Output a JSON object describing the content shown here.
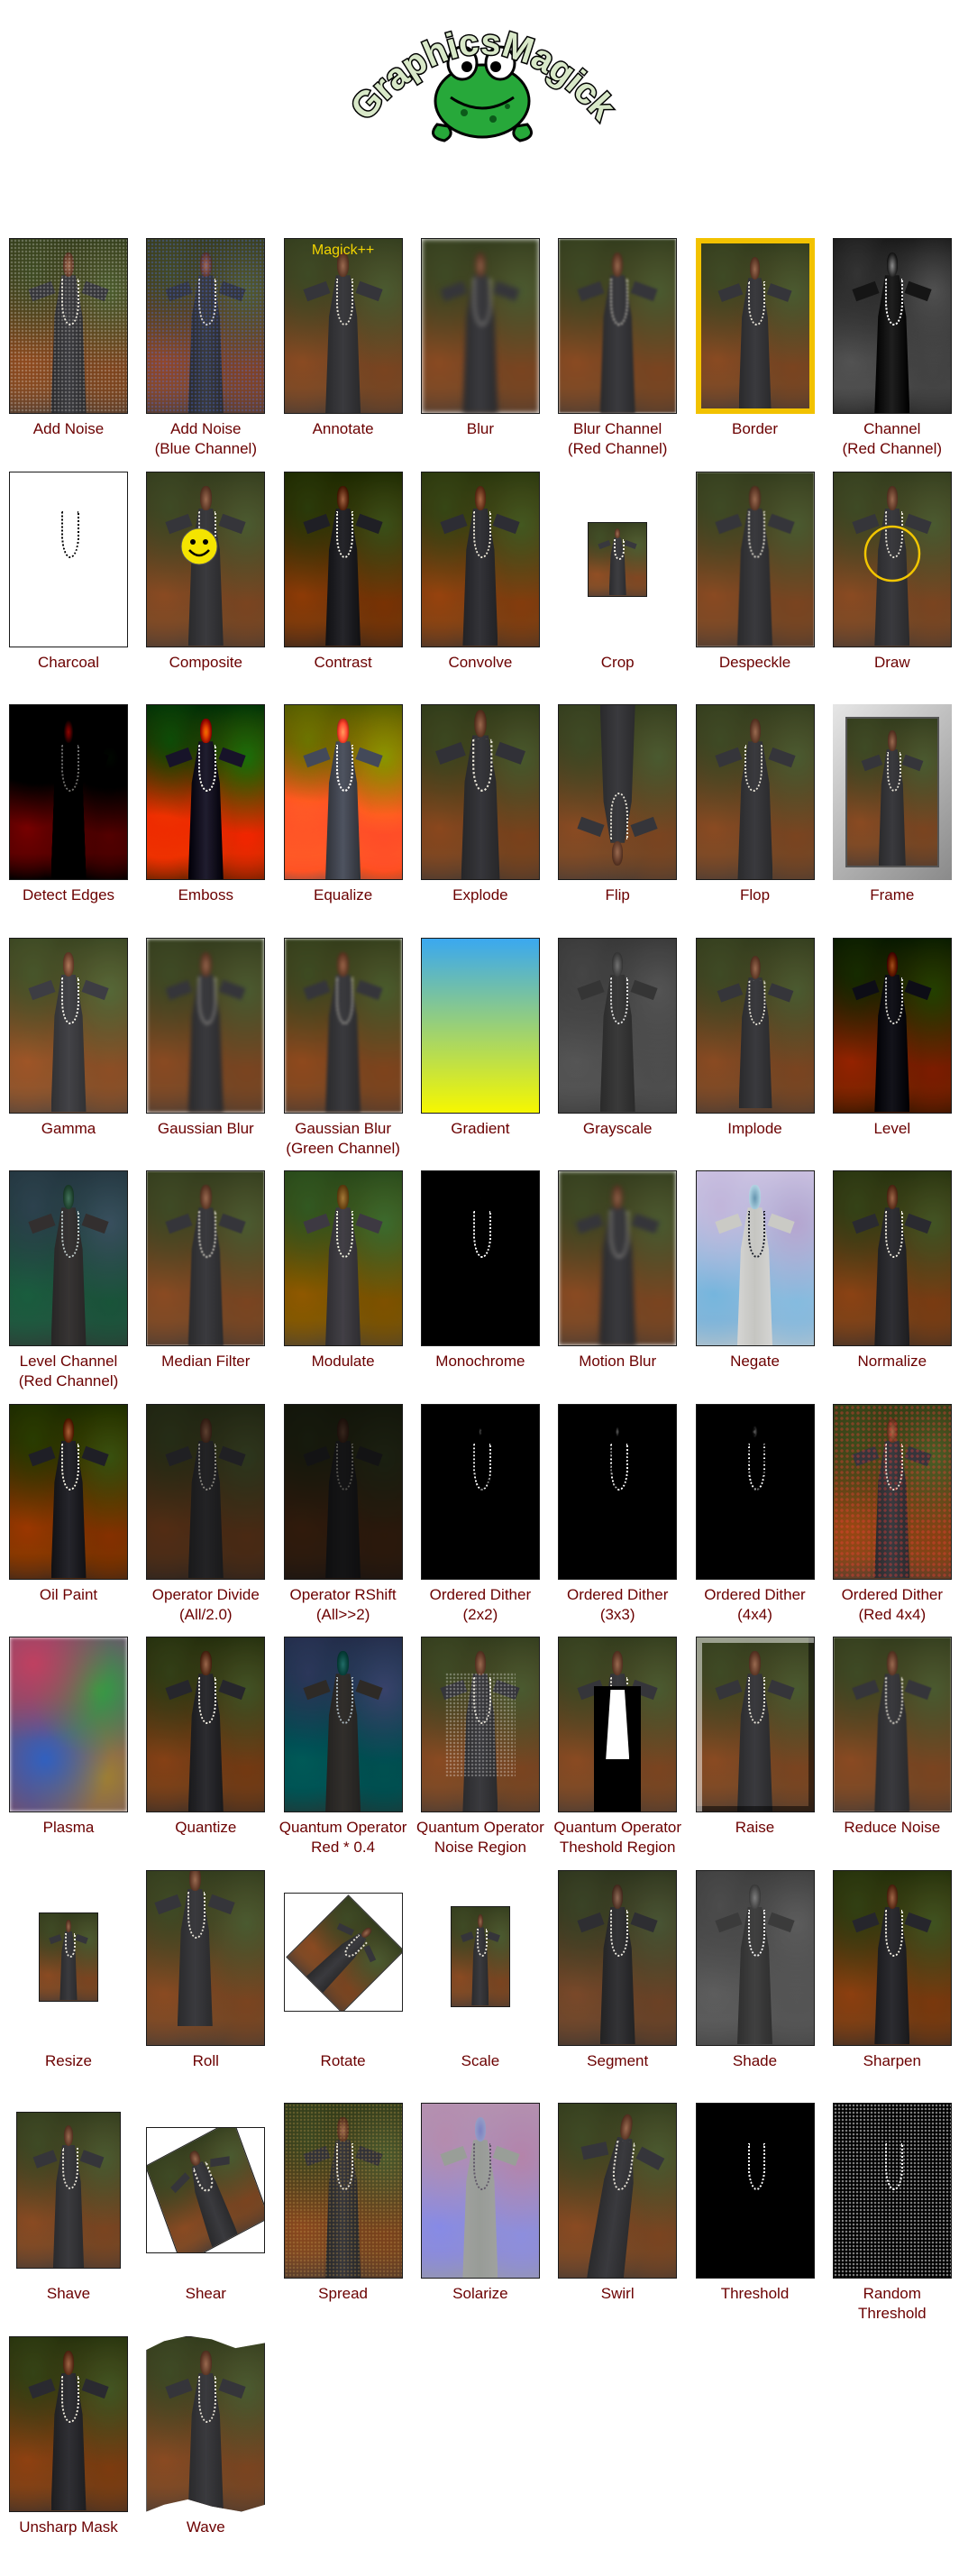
{
  "logo": {
    "text": "GraphicsMagick"
  },
  "colors": {
    "label": "#6b0000",
    "border": "#1a1a1a",
    "border_frame": "#f2c200",
    "annotate": "#f2d400"
  },
  "annotate_text": "Magick++",
  "items": [
    {
      "label": "Add Noise",
      "effect": "noise"
    },
    {
      "label": "Add Noise\n(Blue Channel)",
      "effect": "noise-blue"
    },
    {
      "label": "Annotate",
      "effect": "annotate"
    },
    {
      "label": "Blur",
      "effect": "blur"
    },
    {
      "label": "Blur Channel\n(Red Channel)",
      "effect": "blur-red"
    },
    {
      "label": "Border",
      "effect": "border"
    },
    {
      "label": "Channel\n(Red Channel)",
      "effect": "channel-red"
    },
    {
      "label": "Charcoal",
      "effect": "charcoal"
    },
    {
      "label": "Composite",
      "effect": "composite"
    },
    {
      "label": "Contrast",
      "effect": "contrast"
    },
    {
      "label": "Convolve",
      "effect": "convolve"
    },
    {
      "label": "Crop",
      "effect": "crop"
    },
    {
      "label": "Despeckle",
      "effect": "despeckle"
    },
    {
      "label": "Draw",
      "effect": "draw"
    },
    {
      "label": "Detect Edges",
      "effect": "edges"
    },
    {
      "label": "Emboss",
      "effect": "emboss"
    },
    {
      "label": "Equalize",
      "effect": "equalize"
    },
    {
      "label": "Explode",
      "effect": "explode"
    },
    {
      "label": "Flip",
      "effect": "flip"
    },
    {
      "label": "Flop",
      "effect": "flop"
    },
    {
      "label": "Frame",
      "effect": "frame"
    },
    {
      "label": "Gamma",
      "effect": "gamma"
    },
    {
      "label": "Gaussian Blur",
      "effect": "gblur"
    },
    {
      "label": "Gaussian Blur\n(Green Channel)",
      "effect": "gblur-green"
    },
    {
      "label": "Gradient",
      "effect": "gradient"
    },
    {
      "label": "Grayscale",
      "effect": "grayscale"
    },
    {
      "label": "Implode",
      "effect": "implode"
    },
    {
      "label": "Level",
      "effect": "level"
    },
    {
      "label": "Level Channel\n(Red Channel)",
      "effect": "level-red"
    },
    {
      "label": "Median Filter",
      "effect": "median"
    },
    {
      "label": "Modulate",
      "effect": "modulate"
    },
    {
      "label": "Monochrome",
      "effect": "mono"
    },
    {
      "label": "Motion Blur",
      "effect": "motion"
    },
    {
      "label": "Negate",
      "effect": "negate"
    },
    {
      "label": "Normalize",
      "effect": "normalize"
    },
    {
      "label": "Oil Paint",
      "effect": "oil"
    },
    {
      "label": "Operator Divide\n(All/2.0)",
      "effect": "divide"
    },
    {
      "label": "Operator RShift\n(All>>2)",
      "effect": "rshift"
    },
    {
      "label": "Ordered Dither\n(2x2)",
      "effect": "dither2"
    },
    {
      "label": "Ordered Dither\n(3x3)",
      "effect": "dither3"
    },
    {
      "label": "Ordered Dither\n(4x4)",
      "effect": "dither4"
    },
    {
      "label": "Ordered Dither\n(Red 4x4)",
      "effect": "dither-red"
    },
    {
      "label": "Plasma",
      "effect": "plasma"
    },
    {
      "label": "Quantize",
      "effect": "quantize"
    },
    {
      "label": "Quantum Operator\nRed * 0.4",
      "effect": "qred"
    },
    {
      "label": "Quantum Operator\nNoise Region",
      "effect": "qnoise"
    },
    {
      "label": "Quantum Operator\nTheshold Region",
      "effect": "qthresh"
    },
    {
      "label": "Raise",
      "effect": "raise"
    },
    {
      "label": "Reduce Noise",
      "effect": "reduce"
    },
    {
      "label": "Resize",
      "effect": "resize"
    },
    {
      "label": "Roll",
      "effect": "roll"
    },
    {
      "label": "Rotate",
      "effect": "rotate"
    },
    {
      "label": "Scale",
      "effect": "scale"
    },
    {
      "label": "Segment",
      "effect": "segment"
    },
    {
      "label": "Shade",
      "effect": "shade"
    },
    {
      "label": "Sharpen",
      "effect": "sharpen"
    },
    {
      "label": "Shave",
      "effect": "shave"
    },
    {
      "label": "Shear",
      "effect": "shear"
    },
    {
      "label": "Spread",
      "effect": "spread"
    },
    {
      "label": "Solarize",
      "effect": "solarize"
    },
    {
      "label": "Swirl",
      "effect": "swirl"
    },
    {
      "label": "Threshold",
      "effect": "threshold"
    },
    {
      "label": "Random\nThreshold",
      "effect": "rthreshold"
    },
    {
      "label": "Unsharp Mask",
      "effect": "unsharp"
    },
    {
      "label": "Wave",
      "effect": "wave"
    }
  ]
}
